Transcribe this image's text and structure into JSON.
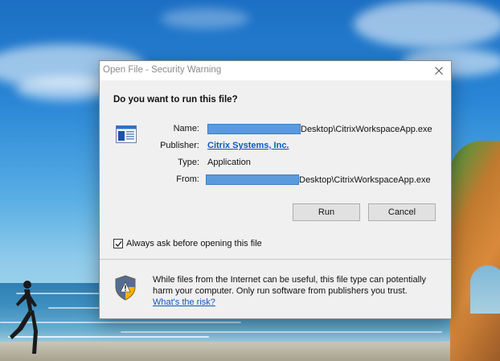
{
  "dialog": {
    "title": "Open File - Security Warning",
    "heading": "Do you want to run this file?",
    "fields": {
      "name": {
        "label": "Name:",
        "value": "Desktop\\CitrixWorkspaceApp.exe"
      },
      "publisher": {
        "label": "Publisher:",
        "value": "Citrix Systems, Inc."
      },
      "type": {
        "label": "Type:",
        "value": "Application"
      },
      "from": {
        "label": "From:",
        "value": "Desktop\\CitrixWorkspaceApp.exe"
      }
    },
    "run_label": "Run",
    "cancel_label": "Cancel",
    "always_ask": {
      "label": "Always ask before opening this file",
      "checked": true
    },
    "warning": {
      "text": "While files from the Internet can be useful, this file type can potentially harm your computer. Only run software from publishers you trust.",
      "link": "What's the risk?"
    }
  },
  "colors": {
    "redaction": "#5b9bdc",
    "link": "#0b58c2",
    "title_text": "#8b8b8b"
  },
  "icons": [
    "close-icon",
    "file-icon",
    "checkmark-icon",
    "shield-icon"
  ]
}
